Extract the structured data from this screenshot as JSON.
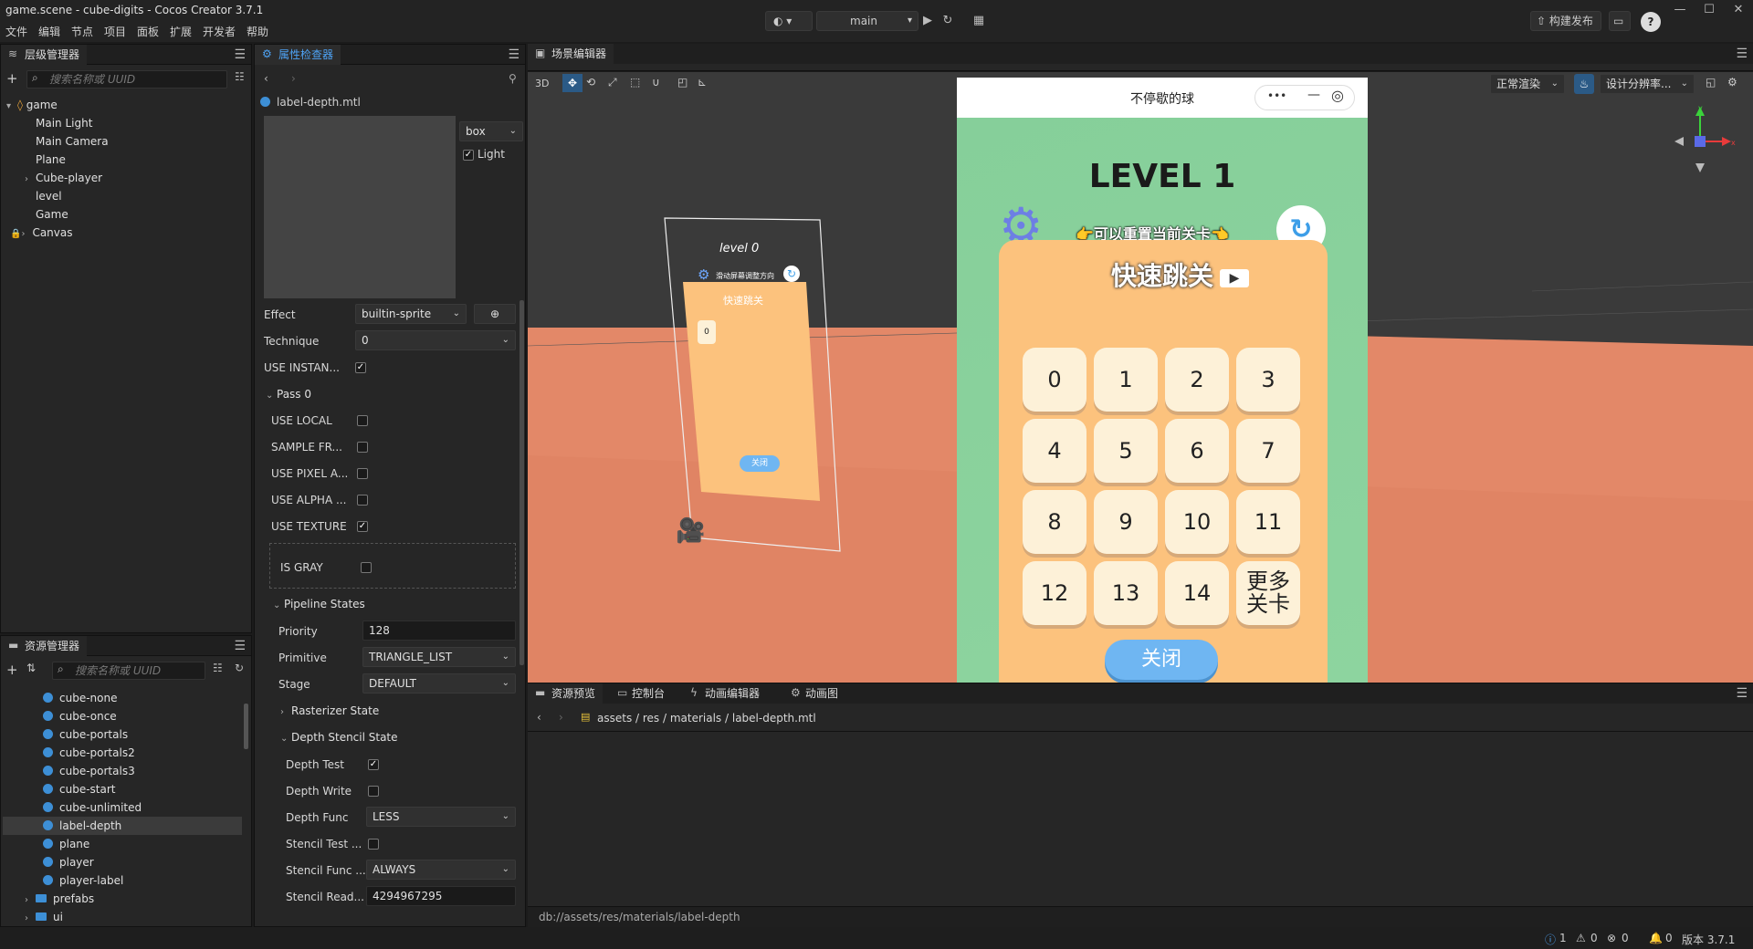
{
  "window": {
    "title": "game.scene - cube-digits - Cocos Creator 3.7.1"
  },
  "menu": [
    "文件",
    "编辑",
    "节点",
    "项目",
    "面板",
    "扩展",
    "开发者",
    "帮助"
  ],
  "toolbar": {
    "scene_select": "main",
    "publish_label": "构建发布"
  },
  "hierarchy": {
    "tab": "层级管理器",
    "search_placeholder": "搜索名称或 UUID",
    "nodes": [
      "game",
      "Main Light",
      "Main Camera",
      "Plane",
      "Cube-player",
      "level",
      "Game",
      "Canvas"
    ]
  },
  "inspector": {
    "tab": "属性检查器",
    "file": "label-depth.mtl",
    "preview_shape": "box",
    "preview_light": "Light",
    "effect_label": "Effect",
    "effect_value": "builtin-sprite",
    "technique_label": "Technique",
    "technique_value": "0",
    "use_instancing": "USE INSTAN...",
    "pass_label": "Pass 0",
    "use_local": "USE LOCAL",
    "sample_from": "SAMPLE FR...",
    "use_pixel": "USE PIXEL A...",
    "use_alpha": "USE ALPHA ...",
    "use_texture": "USE TEXTURE",
    "is_gray": "IS GRAY",
    "pipeline_states": "Pipeline States",
    "priority_label": "Priority",
    "priority_value": "128",
    "primitive_label": "Primitive",
    "primitive_value": "TRIANGLE_LIST",
    "stage_label": "Stage",
    "stage_value": "DEFAULT",
    "rasterizer": "Rasterizer State",
    "depth_stencil": "Depth Stencil State",
    "depth_test": "Depth Test",
    "depth_write": "Depth Write",
    "depth_func_label": "Depth Func",
    "depth_func_value": "LESS",
    "stencil_test": "Stencil Test ...",
    "stencil_func_label": "Stencil Func ...",
    "stencil_func_value": "ALWAYS",
    "stencil_read_label": "Stencil Read...",
    "stencil_read_value": "4294967295"
  },
  "assets": {
    "tab": "资源管理器",
    "search_placeholder": "搜索名称或 UUID",
    "items": [
      "cube-none",
      "cube-once",
      "cube-portals",
      "cube-portals2",
      "cube-portals3",
      "cube-start",
      "cube-unlimited",
      "label-depth",
      "plane",
      "player",
      "player-label"
    ],
    "folders": [
      "prefabs",
      "ui"
    ]
  },
  "scene": {
    "tab": "场景编辑器",
    "mode_3d": "3D",
    "render_mode": "正常渲染",
    "resolution": "设计分辨率...",
    "mini_title": "level 0",
    "mini_hint": "滑动屏幕调整方向",
    "mini_panel_title": "快速跳关",
    "mini_close": "关闭",
    "mini_digit": "0"
  },
  "game": {
    "title": "不停歇的球",
    "menu_dots": "•••",
    "level": "LEVEL 1",
    "hint": "可以重置当前关卡",
    "panel_title": "快速跳关",
    "buttons": [
      "0",
      "1",
      "2",
      "3",
      "4",
      "5",
      "6",
      "7",
      "8",
      "9",
      "10",
      "11",
      "12",
      "13",
      "14",
      "更多\n关卡"
    ],
    "close": "关闭"
  },
  "bottom": {
    "tabs": [
      "资源预览",
      "控制台",
      "动画编辑器",
      "动画图"
    ],
    "path": "assets / res / materials / label-depth.mtl",
    "db_path": "db://assets/res/materials/label-depth"
  },
  "status": {
    "info": "1",
    "warn": "0",
    "err": "0",
    "notif": "0",
    "version": "版本 3.7.1"
  },
  "colors": {
    "accent": "#4ea3f5",
    "game_bg": "#86cf9a",
    "panel": "#fcc27d",
    "ground": "#e38868"
  }
}
